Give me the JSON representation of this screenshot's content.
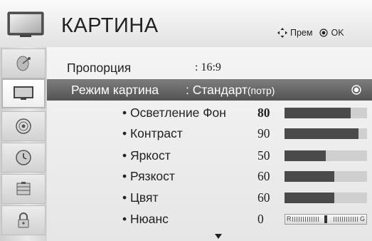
{
  "header": {
    "title": "КАРТИНА",
    "hint_move": "Прем",
    "hint_ok": "OK"
  },
  "sidebar": {
    "items": [
      {
        "icon": "satellite-dish-icon",
        "selected": false
      },
      {
        "icon": "tv-screen-icon",
        "selected": true
      },
      {
        "icon": "speaker-icon",
        "selected": false
      },
      {
        "icon": "clock-icon",
        "selected": false
      },
      {
        "icon": "options-icon",
        "selected": false
      },
      {
        "icon": "lock-icon",
        "selected": false
      }
    ]
  },
  "menu": {
    "aspect": {
      "label": "Пропорция",
      "value": ": 16:9"
    },
    "mode": {
      "label": "Режим картина",
      "value": ": Стандарт",
      "value_suffix": "(потр)"
    },
    "settings": [
      {
        "label": "• Осветление Фон",
        "value": "80",
        "level": 80
      },
      {
        "label": "• Контраст",
        "value": "90",
        "level": 90
      },
      {
        "label": "• Яркост",
        "value": "50",
        "level": 50
      },
      {
        "label": "• Рязкост",
        "value": "60",
        "level": 60
      },
      {
        "label": "• Цвят",
        "value": "60",
        "level": 60
      }
    ],
    "tint": {
      "label": "• Нюанс",
      "value": "0",
      "left_cap": "R",
      "right_cap": "G",
      "level": 0
    }
  },
  "colors": {
    "highlight": "#5e5e5e",
    "bar_fill": "#4a4a4a",
    "bar_track": "#cfcfcf"
  }
}
